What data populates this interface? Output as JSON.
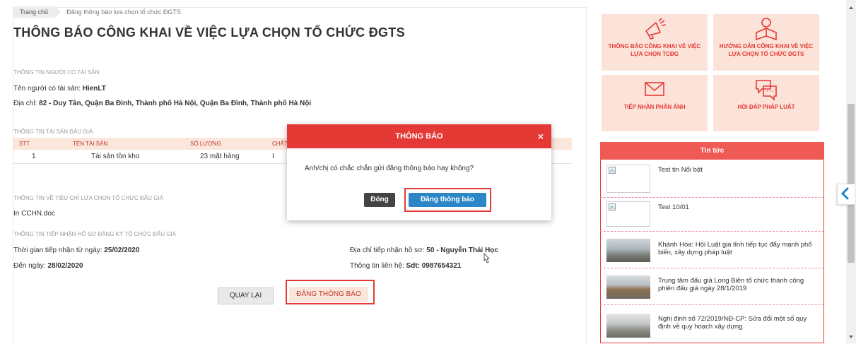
{
  "breadcrumb": {
    "home": "Trang chủ",
    "current": "Đăng thông báo lựa chọn tổ chức ĐGTS"
  },
  "page_title": "THÔNG BÁO CÔNG KHAI VỀ VIỆC LỰA CHỌN TỔ CHỨC ĐGTS",
  "owner": {
    "section": "THÔNG TIN NGƯỜI CÓ TÀI SẢN",
    "name_label": "Tên người có tài sản:",
    "name_value": "HienLT",
    "address_label": "Địa chỉ:",
    "address_value": "82 - Duy Tân, Quận Ba Đình, Thành phố Hà Nội, Quận Ba Đình, Thành phố Hà Nội"
  },
  "assets": {
    "section": "THÔNG TIN TÀI SẢN ĐẤU GIÁ",
    "headers": [
      "STT",
      "TÊN TÀI SẢN",
      "SỐ LƯỢNG",
      "CHẤT LI"
    ],
    "rows": [
      {
        "stt": "1",
        "name": "Tài sản tồn kho",
        "qty": "23 mặt hàng",
        "quality": "I"
      }
    ]
  },
  "criteria": {
    "section": "THÔNG TIN VỀ TIÊU CHÍ LỰA CHỌN TỔ CHỨC ĐẤU GIÁ",
    "file": "In CCHN.doc"
  },
  "reception": {
    "section": "THÔNG TIN TIẾP NHẬN HỒ SƠ ĐĂNG KÝ TỔ CHỨC ĐẤU GIÁ",
    "from_label": "Thời gian tiếp nhận từ ngày:",
    "from_value": "25/02/2020",
    "to_label": "Đến ngày:",
    "to_value": "28/02/2020",
    "addr_label": "Địa chỉ tiếp nhận hồ sơ:",
    "addr_value": "50 - Nguyễn Thái Học",
    "contact_label": "Thông tin liên hệ:",
    "contact_value": "Sdt: 0987654321"
  },
  "buttons": {
    "back": "QUAY LẠI",
    "post": "ĐĂNG THÔNG BÁO"
  },
  "modal": {
    "title": "THÔNG BÁO",
    "close_glyph": "×",
    "message": "Anh/chị có chắc chắn gửi đăng thông báo hay không?",
    "cancel": "Đóng",
    "confirm": "Đăng thông báo"
  },
  "sidebar": {
    "tiles": [
      {
        "label": "THÔNG BÁO CÔNG KHAI VỀ VIỆC LỰA CHỌN TCĐG",
        "icon": "megaphone-icon"
      },
      {
        "label": "HƯỚNG DẪN CÔNG KHAI VỀ VIỆC LỰA CHỌN TỔ CHỨC ĐGTS",
        "icon": "reader-icon"
      },
      {
        "label": "TIẾP NHẬN PHẢN ÁNH",
        "icon": "envelope-icon"
      },
      {
        "label": "HỎI ĐÁP PHÁP LUẬT",
        "icon": "chat-icon"
      }
    ],
    "news_title": "Tin tức",
    "news": [
      "Test tin Nổi bật",
      "Test 10/01",
      "Khánh Hòa: Hội Luật gia tỉnh tiếp tục đẩy mạnh phổ biến, xây dựng pháp luật",
      "Trung tâm đấu giá Long Biên tổ chức thành công phiên đấu giá ngày 28/1/2019",
      "Nghị định số 72/2019/NĐ-CP: Sửa đổi một số quy định về quy hoạch xây dựng"
    ]
  },
  "colors": {
    "accent": "#e53935",
    "tile_bg": "#fbe3da",
    "primary_button": "#2a86c7"
  }
}
